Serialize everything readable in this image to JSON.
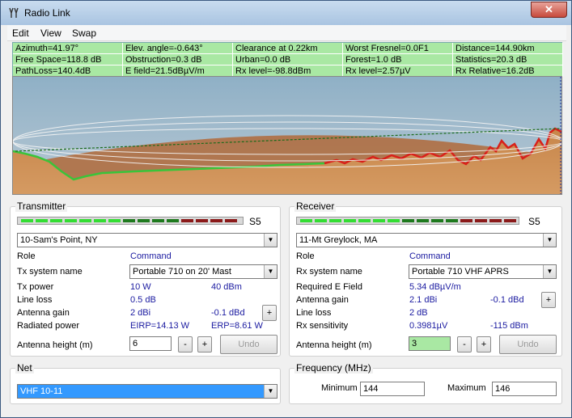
{
  "window": {
    "title": "Radio Link"
  },
  "menu": {
    "edit": "Edit",
    "view": "View",
    "swap": "Swap"
  },
  "stats": [
    [
      "Azimuth=41.97°",
      "Elev. angle=-0.643°",
      "Clearance at 0.22km",
      "Worst Fresnel=0.0F1",
      "Distance=144.90km"
    ],
    [
      "Free Space=118.8 dB",
      "Obstruction=0.3 dB",
      "Urban=0.0 dB",
      "Forest=1.0 dB",
      "Statistics=20.3 dB"
    ],
    [
      "PathLoss=140.4dB",
      "E field=21.5dBµV/m",
      "Rx level=-98.8dBm",
      "Rx level=2.57µV",
      "Rx Relative=16.2dB"
    ]
  ],
  "transmitter": {
    "legend": "Transmitter",
    "signal_label": "S5",
    "site": "10-Sam's Point, NY",
    "role_label": "Role",
    "role_value": "Command",
    "system_label": "Tx system name",
    "system_value": "Portable 710 on 20' Mast",
    "power_label": "Tx power",
    "power_w": "10 W",
    "power_dbm": "40 dBm",
    "line_loss_label": "Line loss",
    "line_loss_value": "0.5 dB",
    "gain_label": "Antenna gain",
    "gain_dbi": "2 dBi",
    "gain_dbd": "-0.1 dBd",
    "radiated_label": "Radiated power",
    "eirp": "EIRP=14.13 W",
    "erp": "ERP=8.61 W",
    "height_label": "Antenna height (m)",
    "height_value": "6",
    "minus": "-",
    "plus": "+",
    "undo": "Undo"
  },
  "receiver": {
    "legend": "Receiver",
    "signal_label": "S5",
    "site": "11-Mt Greylock, MA",
    "role_label": "Role",
    "role_value": "Command",
    "system_label": "Rx system name",
    "system_value": "Portable 710 VHF APRS",
    "efield_label": "Required E Field",
    "efield_value": "5.34 dBµV/m",
    "gain_label": "Antenna gain",
    "gain_dbi": "2.1 dBi",
    "gain_dbd": "-0.1 dBd",
    "line_loss_label": "Line loss",
    "line_loss_value": "2 dB",
    "sens_label": "Rx sensitivity",
    "sens_uv": "0.3981µV",
    "sens_dbm": "-115 dBm",
    "height_label": "Antenna height (m)",
    "height_value": "3",
    "minus": "-",
    "plus": "+",
    "undo": "Undo"
  },
  "net": {
    "legend": "Net",
    "value": "VHF 10-11"
  },
  "frequency": {
    "legend": "Frequency (MHz)",
    "min_label": "Minimum",
    "min_value": "144",
    "max_label": "Maximum",
    "max_value": "146"
  },
  "signal_colors": {
    "bright": "#33dd33",
    "dark": "#1e7a1e",
    "red": "#8b1a1a"
  }
}
